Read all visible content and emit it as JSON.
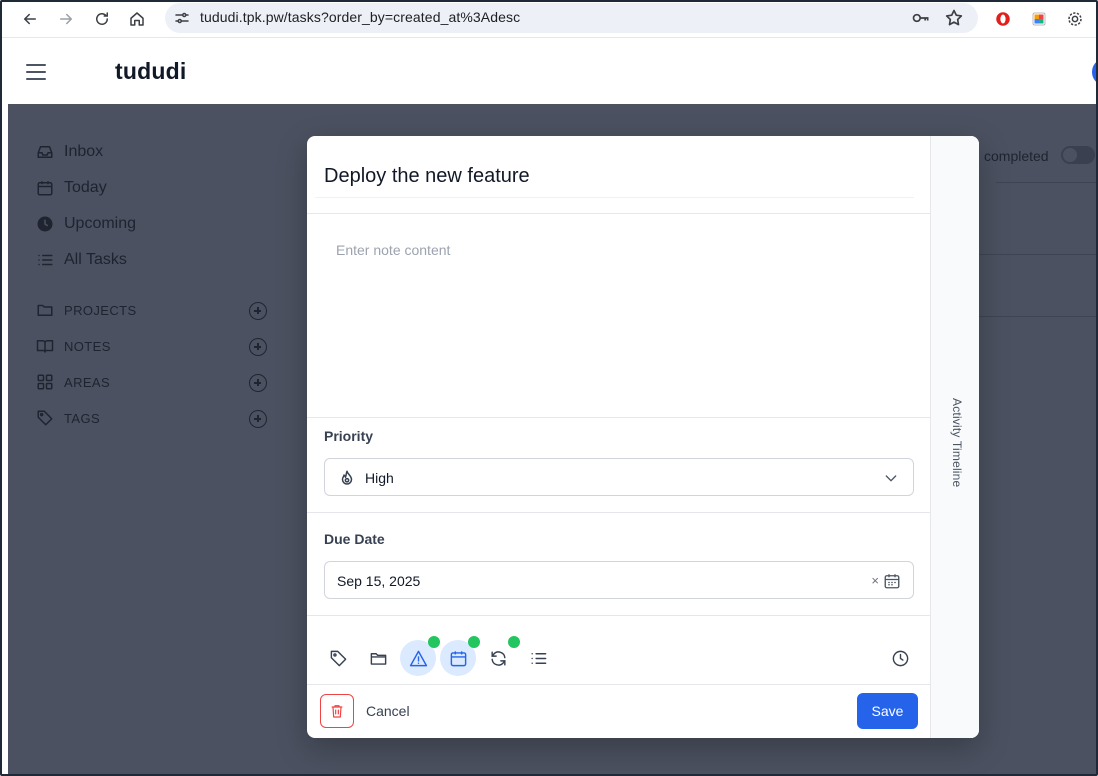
{
  "browser": {
    "url": "tududi.tpk.pw/tasks?order_by=created_at%3Adesc"
  },
  "app": {
    "logo": "tududi"
  },
  "sidebar": {
    "nav": [
      {
        "label": "Inbox",
        "icon": "inbox-icon"
      },
      {
        "label": "Today",
        "icon": "calendar-icon"
      },
      {
        "label": "Upcoming",
        "icon": "clock-icon"
      },
      {
        "label": "All Tasks",
        "icon": "list-icon"
      }
    ],
    "sections": [
      {
        "label": "PROJECTS",
        "icon": "folder-icon"
      },
      {
        "label": "NOTES",
        "icon": "book-icon"
      },
      {
        "label": "AREAS",
        "icon": "grid-icon"
      },
      {
        "label": "TAGS",
        "icon": "tag-icon"
      }
    ]
  },
  "background": {
    "completed_label": "completed"
  },
  "modal": {
    "title_value": "Deploy the new feature",
    "note_placeholder": "Enter note content",
    "priority": {
      "label": "Priority",
      "value": "High"
    },
    "due_date": {
      "label": "Due Date",
      "value": "Sep 15, 2025",
      "clear": "×"
    },
    "timeline_label": "Activity Timeline",
    "toolbar": [
      {
        "icon": "tag-icon",
        "active": false,
        "has_dot": false
      },
      {
        "icon": "folder-icon",
        "active": false,
        "has_dot": false
      },
      {
        "icon": "warning-icon",
        "active": true,
        "has_dot": true
      },
      {
        "icon": "calendar-icon",
        "active": true,
        "has_dot": true
      },
      {
        "icon": "repeat-icon",
        "active": false,
        "has_dot": true
      },
      {
        "icon": "list-icon",
        "active": false,
        "has_dot": false
      },
      {
        "icon": "clock-icon",
        "active": false,
        "has_dot": false
      }
    ],
    "cancel_label": "Cancel",
    "save_label": "Save"
  },
  "colors": {
    "accent": "#2563eb",
    "active_tool_bg": "#dbeafe",
    "dot": "#22c55e",
    "danger": "#ef4444",
    "overlay": "#4b5160"
  }
}
